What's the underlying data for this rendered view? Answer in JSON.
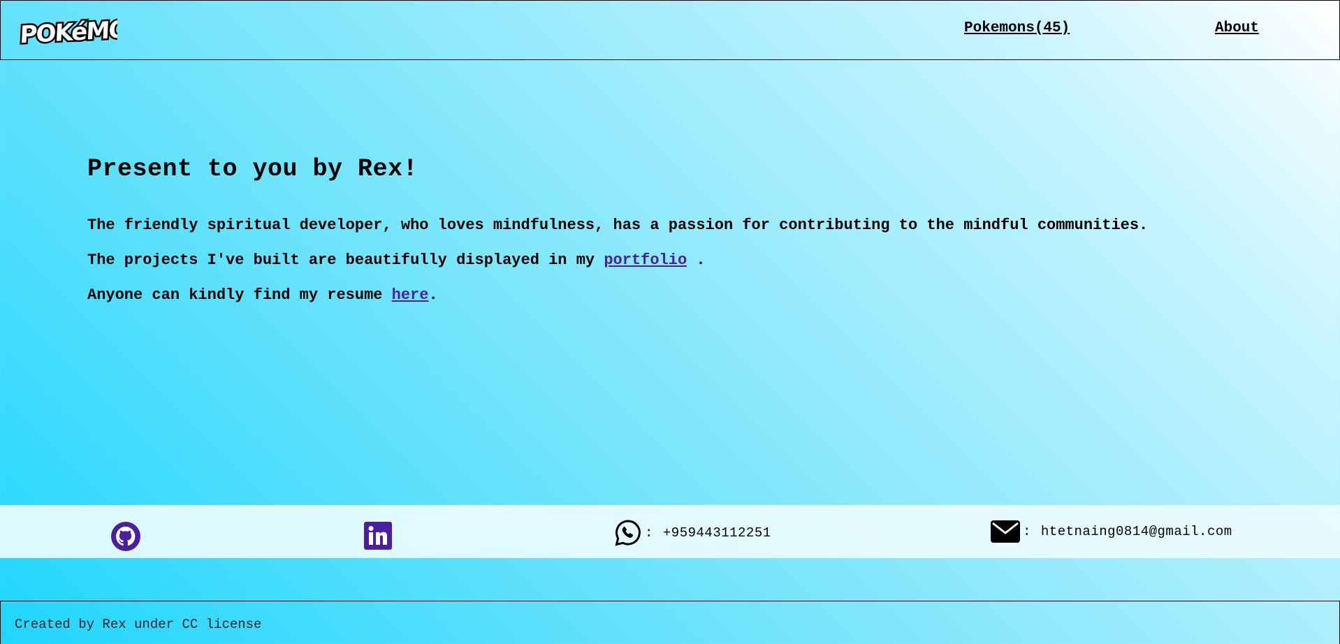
{
  "header": {
    "logo_text": "POKéMON",
    "nav": {
      "pokemons_label": "Pokemons(45)",
      "about_label": "About"
    }
  },
  "main": {
    "title": "Present to you by Rex!",
    "intro": "The friendly spiritual developer, who loves mindfulness, has a passion for contributing to the mindful communities.",
    "projects_prefix": "The projects I've built are beautifully displayed in my ",
    "portfolio_link": "portfolio",
    "projects_suffix": " .",
    "resume_prefix": "Anyone can kindly find my resume ",
    "resume_link": "here",
    "resume_suffix": "."
  },
  "contacts": {
    "phone_separator": ":",
    "phone": "+959443112251",
    "email_separator": ":",
    "email": "htetnaing0814@gmail.com",
    "icons": [
      "github-icon",
      "linkedin-icon",
      "whatsapp-icon",
      "envelope-icon"
    ],
    "icon_color": "#4b1f9e"
  },
  "footer": {
    "text": "Created by Rex under CC license"
  }
}
